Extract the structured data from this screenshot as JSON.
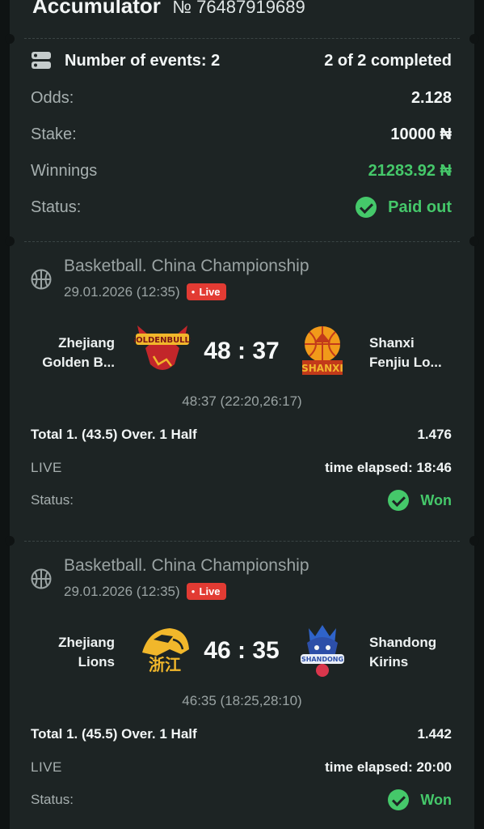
{
  "header": {
    "title": "Accumulator",
    "ticket_number": "№ 76487919689"
  },
  "summary": {
    "events_label": "Number of events: 2",
    "completed_label": "2 of 2 completed",
    "odds_label": "Odds:",
    "odds_value": "2.128",
    "stake_label": "Stake:",
    "stake_value": "10000 ₦",
    "winnings_label": "Winnings",
    "winnings_value": "21283.92 ₦",
    "status_label": "Status:",
    "status_value": "Paid out"
  },
  "events": [
    {
      "league": "Basketball. China Championship",
      "datetime": "29.01.2026 (12:35)",
      "live_badge": "Live",
      "home_team": [
        "Zhejiang",
        "Golden B..."
      ],
      "away_team": [
        "Shanxi",
        "Fenjiu Lo..."
      ],
      "score": "48 : 37",
      "period_scores": "48:37 (22:20,26:17)",
      "bet": "Total 1. (43.5) Over. 1 Half",
      "bet_odds": "1.476",
      "mode": "LIVE",
      "elapsed": "time elapsed: 18:46",
      "status_label": "Status:",
      "status_value": "Won"
    },
    {
      "league": "Basketball. China Championship",
      "datetime": "29.01.2026 (12:35)",
      "live_badge": "Live",
      "home_team": [
        "Zhejiang",
        "Lions"
      ],
      "away_team": [
        "Shandong",
        "Kirins"
      ],
      "score": "46 : 35",
      "period_scores": "46:35 (18:25,28:10)",
      "bet": "Total 1. (45.5) Over. 1 Half",
      "bet_odds": "1.442",
      "mode": "LIVE",
      "elapsed": "time elapsed: 20:00",
      "status_label": "Status:",
      "status_value": "Won"
    }
  ],
  "logos": {
    "home_1": "GOLDENBULLS",
    "away_1": "SHANXI",
    "home_2": "浙江",
    "away_2": "SHANDONG"
  },
  "colors": {
    "accent_green": "#45c86a",
    "live_red": "#e23b33",
    "card_bg": "#1d2424",
    "page_bg": "#0f1313"
  }
}
